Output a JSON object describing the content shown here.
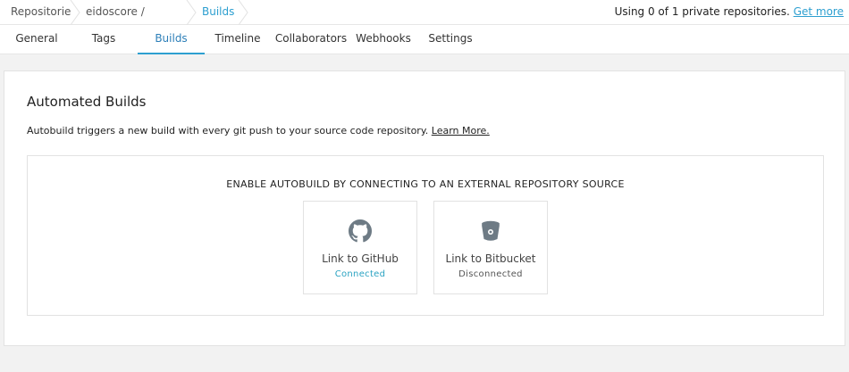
{
  "breadcrumbs": {
    "repositories": "Repositories",
    "path": "eidoscore / frontend",
    "current": "Builds"
  },
  "usage": {
    "text": "Using 0 of 1 private repositories.",
    "link": "Get more"
  },
  "tabs": [
    {
      "label": "General"
    },
    {
      "label": "Tags"
    },
    {
      "label": "Builds",
      "active": true
    },
    {
      "label": "Timeline"
    },
    {
      "label": "Collaborators"
    },
    {
      "label": "Webhooks"
    },
    {
      "label": "Settings"
    }
  ],
  "panel": {
    "title": "Automated Builds",
    "description": "Autobuild triggers a new build with every git push to your source code repository.",
    "learn_more": "Learn More.",
    "heading": "ENABLE AUTOBUILD BY CONNECTING TO AN EXTERNAL REPOSITORY SOURCE",
    "providers": [
      {
        "icon": "github-icon",
        "label": "Link to GitHub",
        "status": "Connected"
      },
      {
        "icon": "bitbucket-icon",
        "label": "Link to Bitbucket",
        "status": "Disconnected"
      }
    ]
  },
  "colors": {
    "accent": "#2d9fd0",
    "connected": "#2aa3c2",
    "icon_gray": "#6e7b85"
  }
}
